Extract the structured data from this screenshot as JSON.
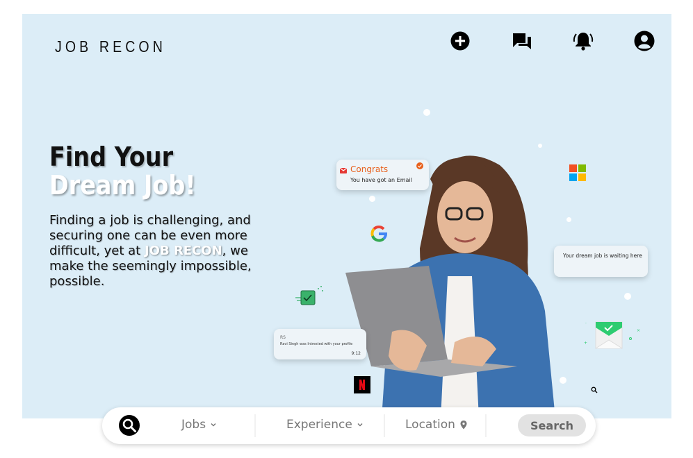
{
  "brand": {
    "logo": "JOB RECON"
  },
  "nav": {
    "icons": [
      "add-circle-icon",
      "chat-icon",
      "notification-bell-icon",
      "account-icon"
    ]
  },
  "hero": {
    "headline_line1": "Find Your",
    "headline_line2": "Dream Job!",
    "sub_part1": "Finding a job is challenging, and securing one can be even more difficult, yet at ",
    "sub_brand": "JOB RECON",
    "sub_part2": ", we make the seemingly impossible, possible."
  },
  "cards": {
    "congrats_title": "Congrats",
    "congrats_sub": "You have got an Email",
    "dream": "Your dream job is waiting here",
    "msg_initials": "RS",
    "msg_text": "Ravi Singh was Intrested with your profile",
    "msg_time": "9:12"
  },
  "search": {
    "jobs": "Jobs",
    "experience": "Experience",
    "location": "Location",
    "button": "Search"
  },
  "colors": {
    "hero_bg": "#dcedf7",
    "congrats_orange": "#e8601c",
    "accent_green": "#2ecc71"
  }
}
